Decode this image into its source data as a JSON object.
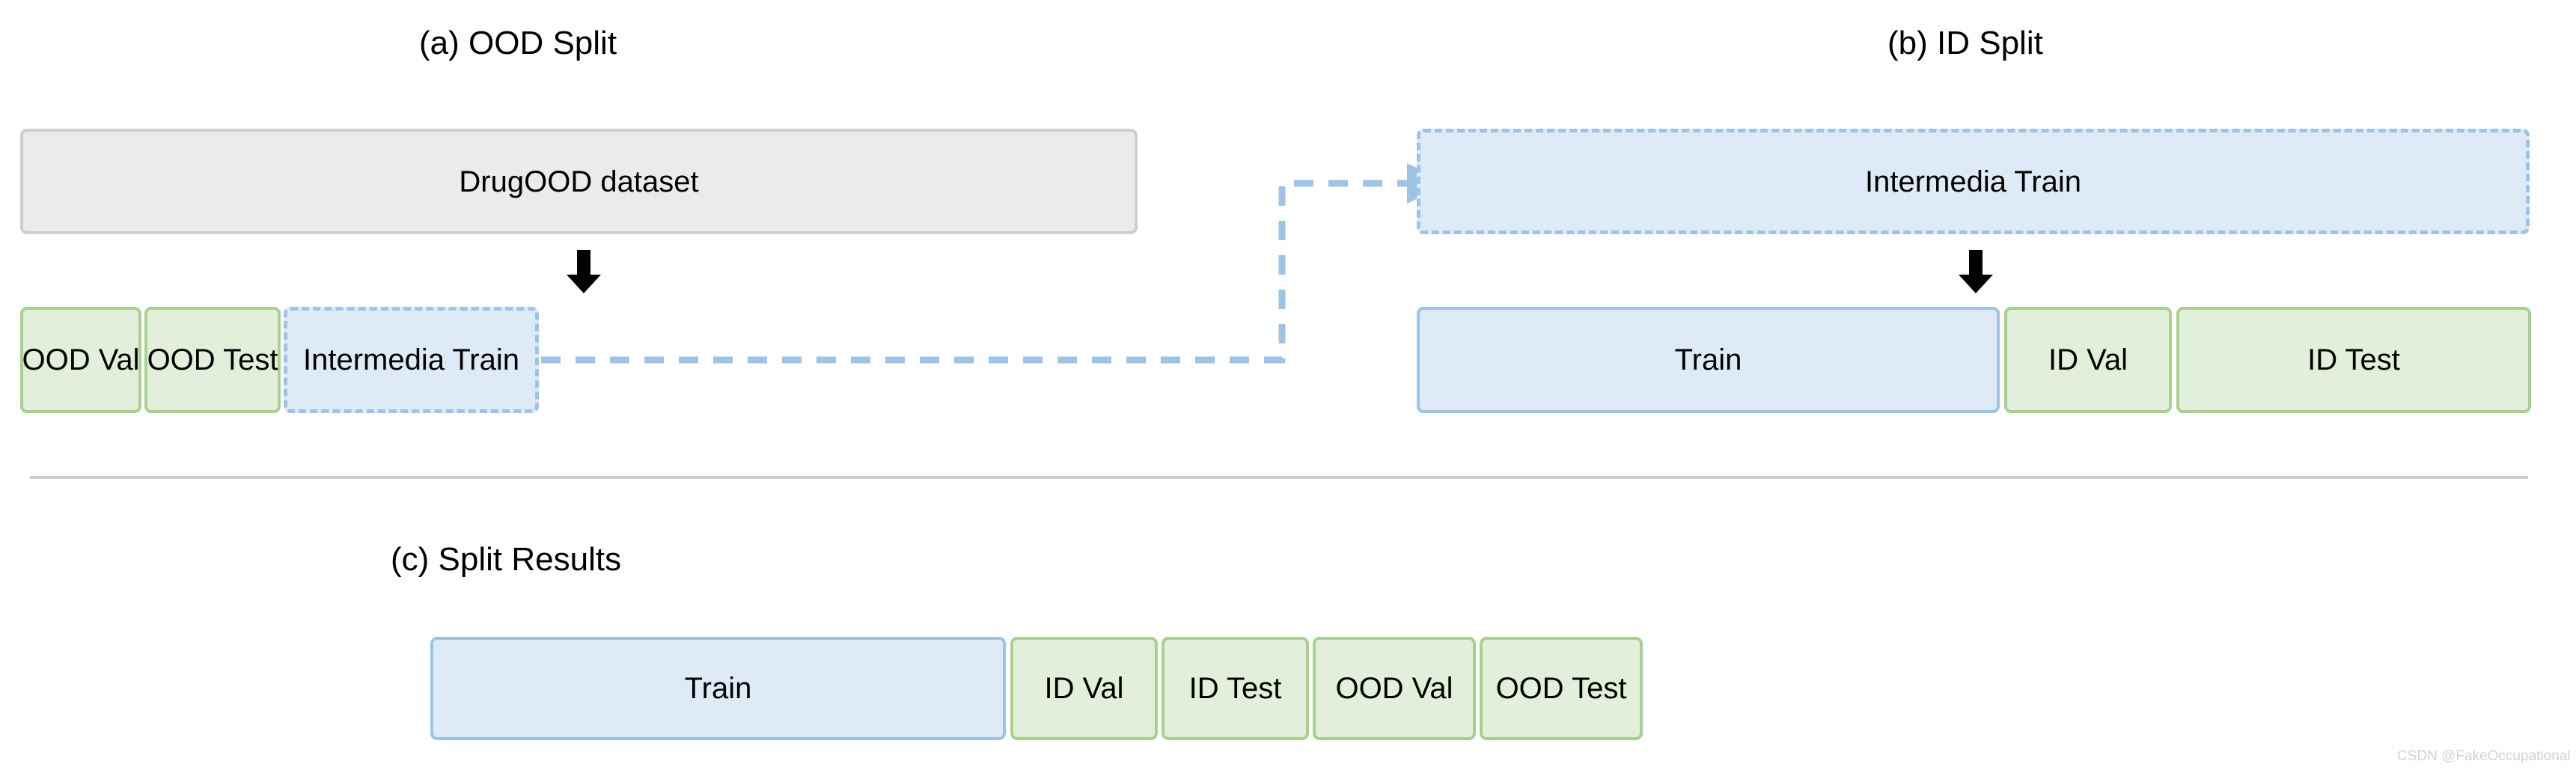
{
  "figure": {
    "watermark": "CSDN @FakeOccupational"
  },
  "panel_a": {
    "title": "(a) OOD Split",
    "source_box": {
      "label": "DrugOOD dataset"
    },
    "arrow": {
      "name": "down-arrow"
    },
    "split_row": [
      {
        "label": "OOD Val",
        "style": "green"
      },
      {
        "label": "OOD Test",
        "style": "green"
      },
      {
        "label": "Intermedia Train",
        "style": "blue-dashed"
      }
    ]
  },
  "panel_b": {
    "title": "(b) ID Split",
    "source_box": {
      "label": "Intermedia Train"
    },
    "arrow": {
      "name": "down-arrow"
    },
    "split_row": [
      {
        "label": "Train",
        "style": "blue-solid"
      },
      {
        "label": "ID Val",
        "style": "green"
      },
      {
        "label": "ID Test",
        "style": "green"
      }
    ]
  },
  "panel_c": {
    "title": "(c) Split Results",
    "split_row": [
      {
        "label": "Train",
        "style": "blue-solid"
      },
      {
        "label": "ID Val",
        "style": "green"
      },
      {
        "label": "ID Test",
        "style": "green"
      },
      {
        "label": "OOD Val",
        "style": "green"
      },
      {
        "label": "OOD Test",
        "style": "green"
      }
    ]
  },
  "colors": {
    "green_fill": "#e2efda",
    "green_border": "#a9d18e",
    "blue_fill": "#deeaf6",
    "blue_border": "#9dc3e6",
    "gray_fill": "#ebebeb",
    "gray_border": "#cfcfcf",
    "arrow_black": "#000000",
    "divider": "#cdcdcd",
    "watermark": "#d2d2d2"
  }
}
